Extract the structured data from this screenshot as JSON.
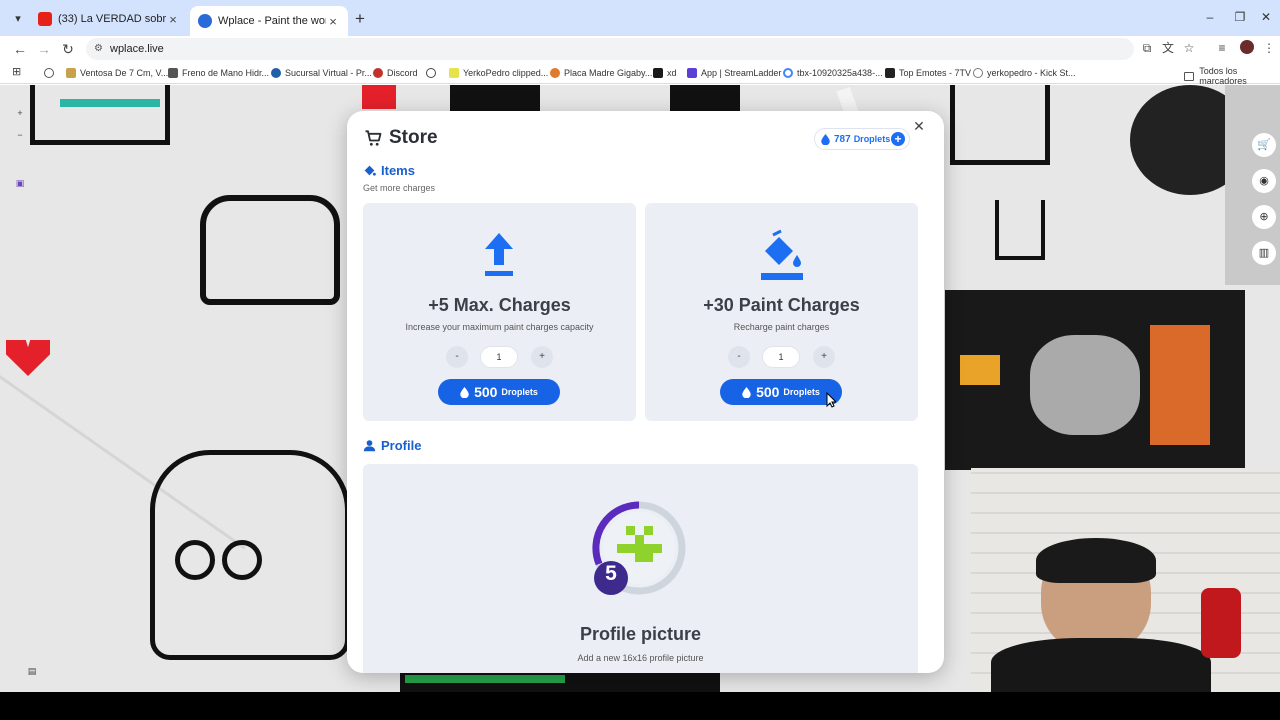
{
  "browser": {
    "tabs": [
      {
        "title": "(33) La VERDAD sobre el torneo",
        "favicon_color": "#e62117",
        "active": false
      },
      {
        "title": "Wplace - Paint the world",
        "favicon_color": "#2a6ad8",
        "active": true
      }
    ],
    "url": "wplace.live",
    "bookmarks": [
      {
        "label": "Ventosa De 7 Cm, V...",
        "color": "#c8a24a"
      },
      {
        "label": "Freno de Mano Hidr...",
        "color": "#555555"
      },
      {
        "label": "Sucursal Virtual - Pr...",
        "color": "#1f5fa8"
      },
      {
        "label": "Discord",
        "color": "#c3312b"
      },
      {
        "label": "",
        "color": "#444444"
      },
      {
        "label": "YerkoPedro clipped...",
        "color": "#e6e24a"
      },
      {
        "label": "Placa Madre Gigaby...",
        "color": "#e07a2c"
      },
      {
        "label": "xd",
        "color": "#1a1a1a"
      },
      {
        "label": "App | StreamLadder",
        "color": "#5b3fd6"
      },
      {
        "label": "tbx-10920325a438-...",
        "color": "#4285f4"
      },
      {
        "label": "Top Emotes - 7TV",
        "color": "#222222"
      },
      {
        "label": "yerkopedro - Kick St...",
        "color": "#7a7a7a"
      }
    ],
    "bookmarks_folder": "Todos los marcadores"
  },
  "store": {
    "title": "Store",
    "droplets_balance": "787",
    "droplets_label": "Droplets",
    "items_section": {
      "heading": "Items",
      "subtitle": "Get more charges"
    },
    "items": [
      {
        "title": "+5 Max. Charges",
        "description": "Increase your maximum paint charges capacity",
        "icon": "upload-arrow-icon",
        "quantity": "1",
        "minus": "-",
        "plus": "+",
        "price": "500",
        "price_unit": "Droplets"
      },
      {
        "title": "+30 Paint Charges",
        "description": "Recharge paint charges",
        "icon": "paint-bucket-icon",
        "quantity": "1",
        "minus": "-",
        "plus": "+",
        "price": "500",
        "price_unit": "Droplets"
      }
    ],
    "profile_section": {
      "heading": "Profile",
      "level": "5",
      "item_title": "Profile picture",
      "item_description": "Add a new 16x16 profile picture"
    },
    "accent_color": "#1763e6"
  }
}
